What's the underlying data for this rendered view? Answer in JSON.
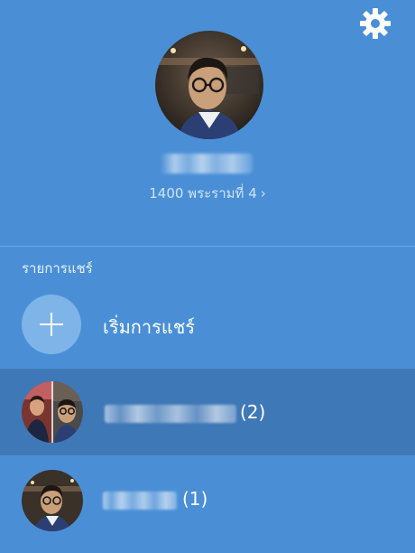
{
  "header": {
    "settings_icon": "gear-icon",
    "status_text": "1400 พระรามที่ 4",
    "status_chevron": "›"
  },
  "chats_section": {
    "label": "รายการแชร์",
    "start_chat_label": "เริ่มการแชร์",
    "items": [
      {
        "count": "(2)",
        "selected": true
      },
      {
        "count": "(1)",
        "selected": false
      }
    ]
  },
  "colors": {
    "background": "#4a8fd6",
    "selected_row": "#3f78b7",
    "plus_circle": "#7eb4e8"
  }
}
